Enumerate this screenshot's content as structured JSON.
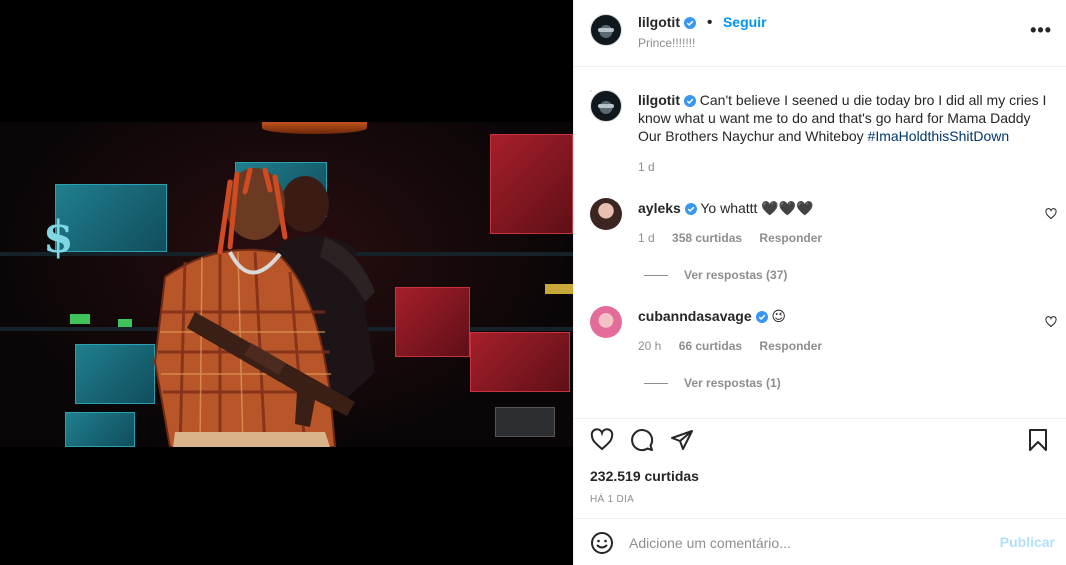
{
  "post": {
    "author": "lilgotit",
    "follow_label": "Seguir",
    "dot": "•",
    "subtitle": "Prince!!!!!!!",
    "more_label": "•••"
  },
  "caption": {
    "author": "lilgotit",
    "text": "Can't believe I seened u die today bro I did all my cries I know what u want me to do and that's go hard for Mama Daddy Our Brothers Naychur and Whiteboy ",
    "hashtag": "#ImaHoldthisShitDown",
    "age": "1 d"
  },
  "comments": [
    {
      "author": "ayleks",
      "text": "Yo whattt 🖤🖤🖤",
      "age": "1 d",
      "likes": "358 curtidas",
      "reply_label": "Responder",
      "view_replies": "Ver respostas (37)"
    },
    {
      "author": "cubanndasavage",
      "text": "😉",
      "age": "20 h",
      "likes": "66 curtidas",
      "reply_label": "Responder",
      "view_replies": "Ver respostas (1)"
    }
  ],
  "stats": {
    "likes": "232.519 curtidas",
    "time": "HÁ 1 DIA"
  },
  "composer": {
    "placeholder": "Adicione um comentário...",
    "publish_label": "Publicar"
  },
  "colors": {
    "accent": "#0095f6",
    "verified": "#3897f0",
    "muted": "#8e8e8e",
    "publish_disabled": "#b2dffc"
  },
  "icons": [
    "verified-badge-icon",
    "more-options-icon",
    "heart-icon",
    "comment-icon",
    "share-icon",
    "bookmark-icon",
    "emoji-icon"
  ]
}
